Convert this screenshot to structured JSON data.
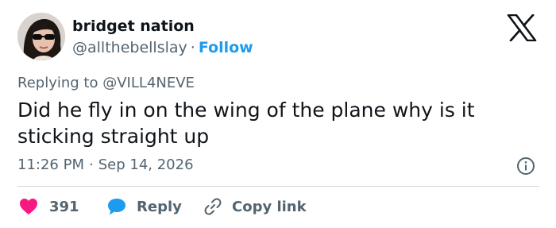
{
  "author": {
    "name": "bridget nation",
    "handle": "@allthebellslay",
    "separator": "·",
    "follow_label": "Follow"
  },
  "reply_context": {
    "prefix": "Replying to",
    "mention": "@VILL4NEVE"
  },
  "tweet": {
    "text": "Did he fly in on the wing of the plane why is it sticking straight up"
  },
  "meta": {
    "time": "11:26 PM",
    "separator": "·",
    "date": "Sep 14, 2026"
  },
  "actions": {
    "like_count": "391",
    "reply_label": "Reply",
    "copy_link_label": "Copy link"
  },
  "icons": {
    "logo": "x-logo-icon",
    "info": "info-icon",
    "like": "heart-icon",
    "reply": "speech-bubble-icon",
    "copy": "link-icon"
  },
  "colors": {
    "like": "#f91880",
    "reply": "#1d9bf0",
    "follow": "#1d9bf0",
    "text_primary": "#0f1419",
    "text_secondary": "#536471"
  }
}
